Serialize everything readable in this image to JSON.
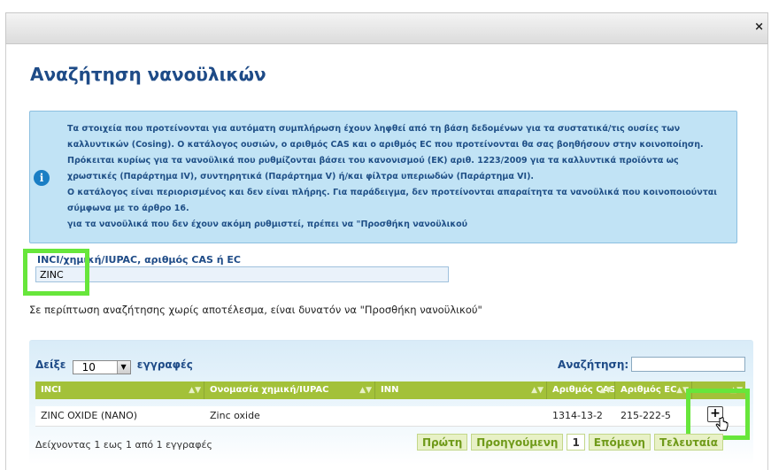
{
  "dialog": {
    "close_label": "×"
  },
  "page": {
    "title": "Αναζήτηση νανοϋλικών"
  },
  "info": {
    "icon": "info-icon",
    "lines": [
      "Τα στοιχεία που προτείνονται για αυτόματη συμπλήρωση έχουν ληφθεί από τη βάση δεδομένων για τα συστατικά/τις ουσίες των",
      "καλλυντικών (Cosing). Ο κατάλογος ουσιών, ο αριθμός CAS και ο αριθμός EC που προτείνονται θα σας βοηθήσουν στην κοινοποίηση.",
      "Πρόκειται κυρίως για τα νανοϋλικά που ρυθμίζονται βάσει του κανονισμού (ΕΚ) αριθ. 1223/2009 για τα καλλυντικά προϊόντα ως",
      "χρωστικές (Παράρτημα IV), συντηρητικά (Παράρτημα V) ή/και φίλτρα υπεριωδών (Παράρτημα VI).",
      "Ο κατάλογος είναι περιορισμένος και δεν είναι πλήρης. Για παράδειγμα, δεν προτείνονται απαραίτητα τα νανοϋλικά που κοινοποιούνται",
      "σύμφωνα με το άρθρο 16.",
      "για τα νανοϋλικά που δεν έχουν ακόμη ρυθμιστεί, πρέπει να \"Προσθήκη νανοϋλικού"
    ]
  },
  "search": {
    "label": "INCI/χημική/IUPAC, αριθμός CAS ή EC",
    "value": "ZINC",
    "hint": "Σε περίπτωση αναζήτησης χωρίς αποτέλεσμα, είναι δυνατόν να \"Προσθήκη νανοϋλικού\""
  },
  "table": {
    "show_prefix": "Δείξε",
    "page_size": "10",
    "show_suffix": "εγγραφές",
    "search_label": "Αναζήτηση:",
    "search_value": "",
    "headers": [
      "INCI",
      "Ονομασία χημική/IUPAC",
      "INN",
      "Αριθμός CAS",
      "Αριθμός EC",
      ""
    ],
    "rows": [
      {
        "inci": "ZINC OXIDE (NANO)",
        "iupac": "Zinc oxide",
        "inn": "",
        "cas": "1314-13-2",
        "ec": "215-222-5",
        "action": "+"
      }
    ],
    "info": "Δείχνοντας 1 εως 1 από 1 εγγραφές",
    "pager": {
      "first": "Πρώτη",
      "prev": "Προηγούμενη",
      "current": "1",
      "next": "Επόμενη",
      "last": "Τελευταία"
    }
  },
  "colors": {
    "accent": "#a3c139",
    "title": "#1e4b87",
    "info_bg": "#c1e3f5",
    "highlight": "#67e63b"
  }
}
